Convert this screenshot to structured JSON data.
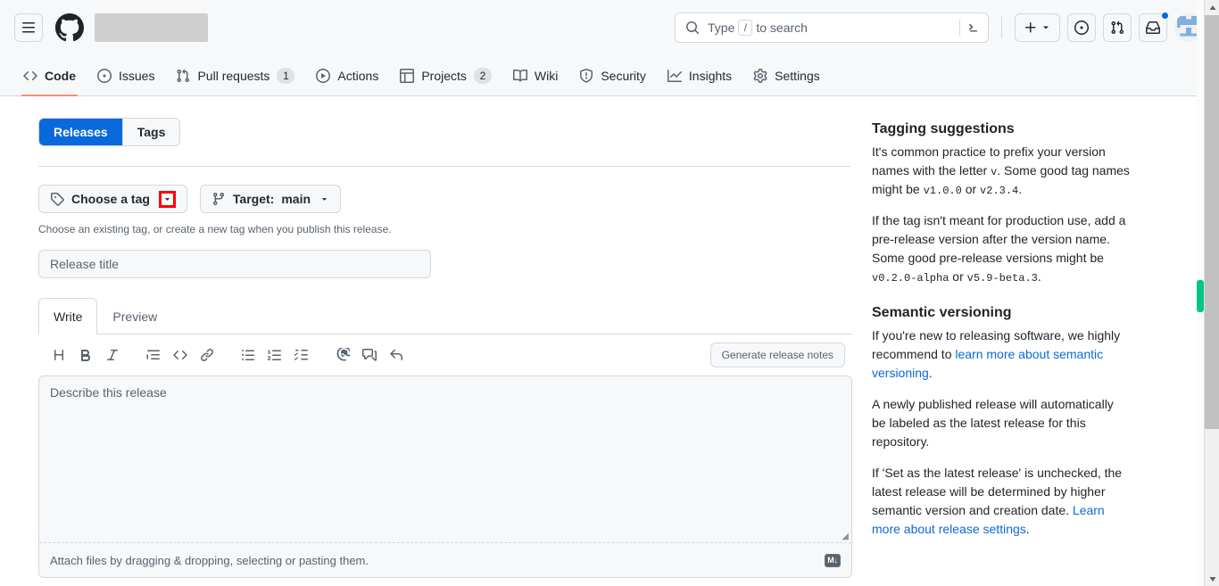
{
  "header": {
    "hamburger_label": "Open global navigation menu",
    "logo_label": "GitHub",
    "repo_name_redacted": "",
    "search": {
      "placeholder_prefix": "Type",
      "slash_key": "/",
      "placeholder_suffix": "to search",
      "command_palette_label": ">_"
    },
    "create_new_label": "+",
    "issues_icon_label": "issues",
    "pull_requests_icon_label": "pull-requests",
    "inbox_label": "inbox",
    "avatar_label": "user avatar"
  },
  "repo_nav": {
    "items": [
      {
        "label": "Code",
        "icon": "code-icon",
        "count": null,
        "selected": true
      },
      {
        "label": "Issues",
        "icon": "issue-opened-icon",
        "count": null,
        "selected": false
      },
      {
        "label": "Pull requests",
        "icon": "git-pull-request-icon",
        "count": "1",
        "selected": false
      },
      {
        "label": "Actions",
        "icon": "play-icon",
        "count": null,
        "selected": false
      },
      {
        "label": "Projects",
        "icon": "table-icon",
        "count": "2",
        "selected": false
      },
      {
        "label": "Wiki",
        "icon": "book-icon",
        "count": null,
        "selected": false
      },
      {
        "label": "Security",
        "icon": "shield-icon",
        "count": null,
        "selected": false
      },
      {
        "label": "Insights",
        "icon": "graph-icon",
        "count": null,
        "selected": false
      },
      {
        "label": "Settings",
        "icon": "gear-icon",
        "count": null,
        "selected": false
      }
    ]
  },
  "main": {
    "segmented": {
      "releases_label": "Releases",
      "tags_label": "Tags",
      "active": "Releases"
    },
    "choose_tag": {
      "label": "Choose a tag",
      "icon": "tag-icon",
      "caret": "chevron-down"
    },
    "target": {
      "prefix": "Target:",
      "value": "main",
      "icon": "git-branch-icon"
    },
    "help_text": "Choose an existing tag, or create a new tag when you publish this release.",
    "release_title": {
      "value": "",
      "placeholder": "Release title"
    },
    "editor": {
      "write_tab": "Write",
      "preview_tab": "Preview",
      "active_tab": "Write",
      "toolbar": [
        {
          "name": "heading-icon",
          "glyph": "H"
        },
        {
          "name": "bold-icon",
          "glyph": "B"
        },
        {
          "name": "italic-icon",
          "glyph": "I"
        },
        {
          "name": "quote-icon",
          "glyph": "quote"
        },
        {
          "name": "code-icon",
          "glyph": "<>"
        },
        {
          "name": "link-icon",
          "glyph": "link"
        },
        {
          "name": "unordered-list-icon",
          "glyph": "ul"
        },
        {
          "name": "ordered-list-icon",
          "glyph": "ol"
        },
        {
          "name": "task-list-icon",
          "glyph": "tasklist"
        },
        {
          "name": "mention-icon",
          "glyph": "@"
        },
        {
          "name": "cross-reference-icon",
          "glyph": "xref"
        },
        {
          "name": "saved-reply-icon",
          "glyph": "reply"
        }
      ],
      "generate_notes_label": "Generate release notes",
      "body": {
        "value": "",
        "placeholder": "Describe this release"
      },
      "attach_text": "Attach files by dragging & dropping, selecting or pasting them.",
      "markdown_badge": "M↓"
    }
  },
  "sidebar": {
    "tagging": {
      "heading": "Tagging suggestions",
      "p1_a": "It's common practice to prefix your version names with the letter ",
      "p1_v": "v",
      "p1_b": ". Some good tag names might be ",
      "p1_code1": "v1.0.0",
      "p1_c": " or ",
      "p1_code2": "v2.3.4",
      "p1_d": ".",
      "p2_a": "If the tag isn't meant for production use, add a pre-release version after the version name. Some good pre-release versions might be ",
      "p2_code1": "v0.2.0-alpha",
      "p2_b": " or ",
      "p2_code2": "v5.9-beta.3",
      "p2_c": "."
    },
    "semver": {
      "heading": "Semantic versioning",
      "p1_a": "If you're new to releasing software, we highly recommend to ",
      "p1_link": "learn more about semantic versioning",
      "p1_b": ".",
      "p2": "A newly published release will automatically be labeled as the latest release for this repository.",
      "p3_a": "If 'Set as the latest release' is unchecked, the latest release will be determined by higher semantic version and creation date. ",
      "p3_link": "Learn more about release settings",
      "p3_b": "."
    }
  },
  "colors": {
    "accent_blue": "#0969da",
    "nav_underline": "#fd8c73",
    "highlight_red": "#ff0000",
    "find_marker_green": "#00c781",
    "surface": "#f6f8fa",
    "border": "#d1d9e0"
  },
  "scrollbar": {
    "up_arrow": "▲",
    "down_arrow": "▼"
  }
}
